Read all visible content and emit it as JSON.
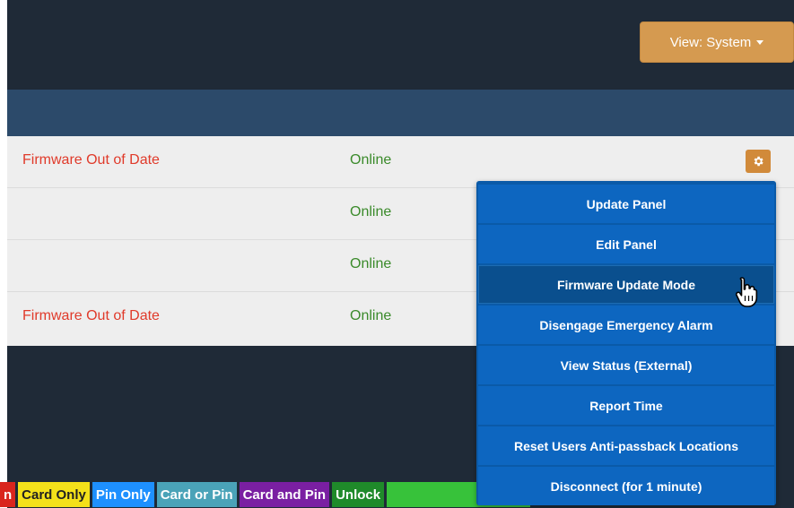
{
  "header": {
    "view_button": "View: System"
  },
  "rows": [
    {
      "status": "Firmware Out of Date",
      "connection": "Online"
    },
    {
      "status": "",
      "connection": "Online"
    },
    {
      "status": "",
      "connection": "Online"
    },
    {
      "status": "Firmware Out of Date",
      "connection": "Online"
    }
  ],
  "menu": {
    "items": [
      "Update Panel",
      "Edit Panel",
      "Firmware Update Mode",
      "Disengage Emergency Alarm",
      "View Status (External)",
      "Report Time",
      "Reset Users Anti-passback Locations",
      "Disconnect (for 1 minute)"
    ],
    "hovered_index": 2
  },
  "legend": [
    {
      "label": "n",
      "bg": "#d9251d",
      "fg": "#ffffff"
    },
    {
      "label": "Card Only",
      "bg": "#f4e11a",
      "fg": "#222222"
    },
    {
      "label": "Pin Only",
      "bg": "#1e90ff",
      "fg": "#ffffff"
    },
    {
      "label": "Card or Pin",
      "bg": "#4aa3b8",
      "fg": "#ffffff"
    },
    {
      "label": "Card and Pin",
      "bg": "#7a1fa2",
      "fg": "#ffffff"
    },
    {
      "label": "Unlock",
      "bg": "#1f8a2a",
      "fg": "#ffffff"
    },
    {
      "label": "",
      "bg": "#37c23a",
      "fg": "#ffffff"
    }
  ],
  "icons": {
    "gear": "gear-icon",
    "cursor": "hand-pointer-icon",
    "caret": "caret-down-icon"
  },
  "colors": {
    "topbar": "#1f2a37",
    "table_header": "#2c4a6a",
    "accent_orange": "#d59a50",
    "menu_blue": "#0d66c0",
    "status_red": "#e03a2a",
    "online_green": "#3a8a2a"
  }
}
